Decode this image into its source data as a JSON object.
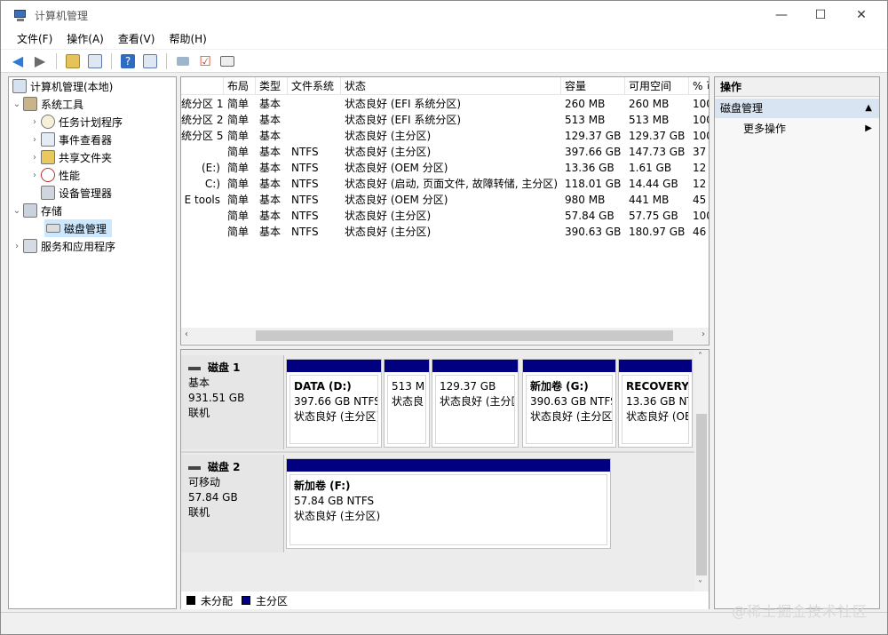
{
  "window": {
    "title": "计算机管理",
    "minimize": "—",
    "maximize": "☐",
    "close": "✕"
  },
  "menu": [
    "文件(F)",
    "操作(A)",
    "查看(V)",
    "帮助(H)"
  ],
  "tree": {
    "root": "计算机管理(本地)",
    "system_tools": "系统工具",
    "task_scheduler": "任务计划程序",
    "event_viewer": "事件查看器",
    "shared_folders": "共享文件夹",
    "performance": "性能",
    "device_manager": "设备管理器",
    "storage": "存储",
    "disk_management": "磁盘管理",
    "services_apps": "服务和应用程序"
  },
  "table": {
    "headers": [
      "布局",
      "类型",
      "文件系统",
      "状态",
      "容量",
      "可用空间",
      "% 可"
    ],
    "rows": [
      [
        "统分区 1)",
        "简单",
        "基本",
        "",
        "状态良好 (EFI 系统分区)",
        "260 MB",
        "260 MB",
        "100"
      ],
      [
        "统分区 2)",
        "简单",
        "基本",
        "",
        "状态良好 (EFI 系统分区)",
        "513 MB",
        "513 MB",
        "100"
      ],
      [
        "统分区 5)",
        "简单",
        "基本",
        "",
        "状态良好 (主分区)",
        "129.37 GB",
        "129.37 GB",
        "100"
      ],
      [
        "",
        "简单",
        "基本",
        "NTFS",
        "状态良好 (主分区)",
        "397.66 GB",
        "147.73 GB",
        "37"
      ],
      [
        "(E:)",
        "简单",
        "基本",
        "NTFS",
        "状态良好 (OEM 分区)",
        "13.36 GB",
        "1.61 GB",
        "12"
      ],
      [
        "C:)",
        "简单",
        "基本",
        "NTFS",
        "状态良好 (启动, 页面文件, 故障转储, 主分区)",
        "118.01 GB",
        "14.44 GB",
        "12"
      ],
      [
        "E tools",
        "简单",
        "基本",
        "NTFS",
        "状态良好 (OEM 分区)",
        "980 MB",
        "441 MB",
        "45"
      ],
      [
        "",
        "简单",
        "基本",
        "NTFS",
        "状态良好 (主分区)",
        "57.84 GB",
        "57.75 GB",
        "100"
      ],
      [
        "",
        "简单",
        "基本",
        "NTFS",
        "状态良好 (主分区)",
        "390.63 GB",
        "180.97 GB",
        "46"
      ]
    ]
  },
  "disks": [
    {
      "name": "磁盘 1",
      "type": "基本",
      "size": "931.51 GB",
      "state": "联机",
      "partitions": [
        {
          "name": "DATA  (D:)",
          "size": "397.66 GB NTFS",
          "status": "状态良好 (主分区)"
        },
        {
          "name": "",
          "size": "513 M",
          "status": "状态良"
        },
        {
          "name": "",
          "size": "129.37 GB",
          "status": "状态良好 (主分区)"
        },
        {
          "name": "新加卷  (G:)",
          "size": "390.63 GB NTFS",
          "status": "状态良好 (主分区)"
        },
        {
          "name": "RECOVERY",
          "size": "13.36 GB NTFS",
          "status": "状态良好 (OEM"
        }
      ]
    },
    {
      "name": "磁盘 2",
      "type": "可移动",
      "size": "57.84 GB",
      "state": "联机",
      "partitions": [
        {
          "name": "新加卷  (F:)",
          "size": "57.84 GB NTFS",
          "status": "状态良好 (主分区)"
        }
      ]
    }
  ],
  "legend": [
    {
      "label": "未分配",
      "color": "#000000"
    },
    {
      "label": "主分区",
      "color": "#000080"
    }
  ],
  "actions": {
    "title": "操作",
    "section": "磁盘管理",
    "more": "更多操作"
  },
  "watermark": "@稀土掘金技术社区"
}
